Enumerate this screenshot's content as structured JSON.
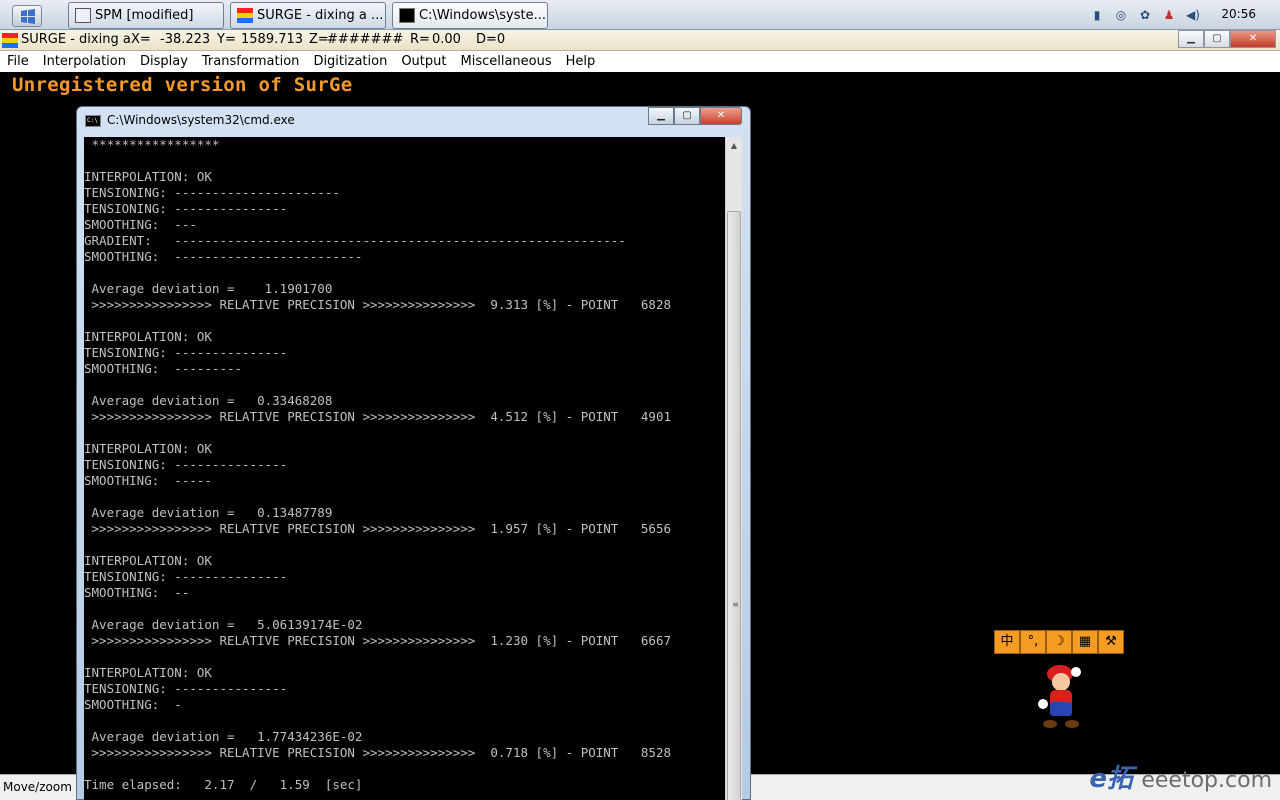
{
  "taskbar": {
    "tasks": [
      {
        "label": "SPM [modified]"
      },
      {
        "label": "SURGE - dixing a    ..."
      },
      {
        "label": "C:\\Windows\\syste..."
      }
    ],
    "clock": "20:56"
  },
  "surge": {
    "title": "SURGE - dixing a",
    "x_label": "X=",
    "x_value": "-38.223",
    "y_label": "Y=",
    "y_value": "1589.713",
    "z_label": "Z=",
    "z_value": "#######",
    "r_label": "R=",
    "r_value": "0.00",
    "d_label": "D=0",
    "unregistered": "Unregistered version of SurGe",
    "status": "Move/zoom"
  },
  "menu": [
    "File",
    "Interpolation",
    "Display",
    "Transformation",
    "Digitization",
    "Output",
    "Miscellaneous",
    "Help"
  ],
  "cmd": {
    "title": "C:\\Windows\\system32\\cmd.exe",
    "lines": [
      " *****************",
      "",
      "INTERPOLATION: OK",
      "TENSIONING: ----------------------",
      "TENSIONING: ---------------",
      "SMOOTHING:  ---",
      "GRADIENT:   ------------------------------------------------------------",
      "SMOOTHING:  -------------------------",
      "",
      " Average deviation =    1.1901700",
      " >>>>>>>>>>>>>>>> RELATIVE PRECISION >>>>>>>>>>>>>>>  9.313 [%] - POINT   6828",
      "",
      "INTERPOLATION: OK",
      "TENSIONING: ---------------",
      "SMOOTHING:  ---------",
      "",
      " Average deviation =   0.33468208",
      " >>>>>>>>>>>>>>>> RELATIVE PRECISION >>>>>>>>>>>>>>>  4.512 [%] - POINT   4901",
      "",
      "INTERPOLATION: OK",
      "TENSIONING: ---------------",
      "SMOOTHING:  -----",
      "",
      " Average deviation =   0.13487789",
      " >>>>>>>>>>>>>>>> RELATIVE PRECISION >>>>>>>>>>>>>>>  1.957 [%] - POINT   5656",
      "",
      "INTERPOLATION: OK",
      "TENSIONING: ---------------",
      "SMOOTHING:  --",
      "",
      " Average deviation =   5.06139174E-02",
      " >>>>>>>>>>>>>>>> RELATIVE PRECISION >>>>>>>>>>>>>>>  1.230 [%] - POINT   6667",
      "",
      "INTERPOLATION: OK",
      "TENSIONING: ---------------",
      "SMOOTHING:  -",
      "",
      " Average deviation =   1.77434236E-02",
      " >>>>>>>>>>>>>>>> RELATIVE PRECISION >>>>>>>>>>>>>>>  0.718 [%] - POINT   8528",
      "",
      "Time elapsed:   2.17  /   1.59  [sec]"
    ]
  },
  "ime": {
    "keys": [
      "中",
      "°,",
      "☽",
      "▦",
      "⚒"
    ]
  },
  "watermark": {
    "brand": "e拓",
    "site": "eeetop.com"
  },
  "colors": {
    "accent": "#f39a2b",
    "console_text": "#c0c0c0"
  }
}
